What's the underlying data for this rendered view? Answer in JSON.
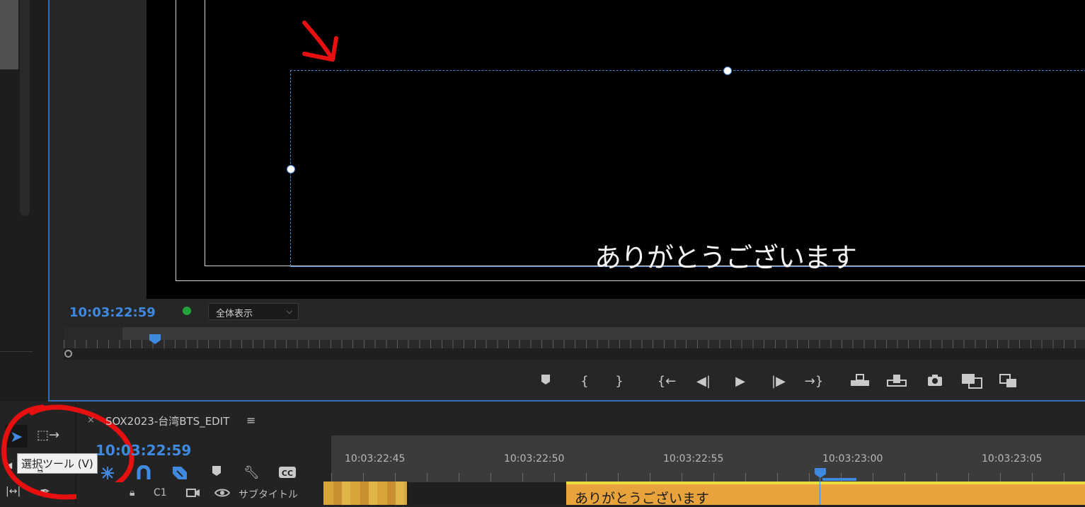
{
  "monitor": {
    "caption_text": "ありがとうございます",
    "timecode": "10:03:22:59",
    "zoom_value": "全体表示",
    "zoom_chevron_icon": "chevron-down-icon"
  },
  "transport_icons": [
    "add-marker-icon",
    "mark-in-icon",
    "mark-out-icon",
    "go-to-in-icon",
    "step-back-icon",
    "play-icon",
    "step-forward-icon",
    "go-to-out-icon",
    "insert-icon",
    "overwrite-icon",
    "export-frame-icon",
    "comparison-view-icon",
    "loop-icon"
  ],
  "tools": {
    "tooltip": "選択ツール (V)",
    "selection_icon": "selection-tool-icon",
    "track_select_icon": "track-select-forward-icon",
    "ripple_icon": "ripple-edit-icon",
    "slip_icon": "slip-tool-icon",
    "pen_icon": "pen-tool-icon"
  },
  "sequence": {
    "tab_name": "SOX2023-台湾BTS_EDIT",
    "close_label": "×",
    "menu_label": "≡",
    "timecode": "10:03:22:59"
  },
  "timeline": {
    "ruler_labels": [
      "10:03:22:45",
      "10:03:22:50",
      "10:03:22:55",
      "10:03:23:00",
      "10:03:23:05"
    ],
    "track": {
      "name": "C1",
      "label": "サブタイトル"
    },
    "caption_clip_text": "ありがとうございます"
  },
  "colors": {
    "accent": "#3f8ae0",
    "annotation_red": "#e61010",
    "caption_clip": "#e8a33c",
    "status_green": "#23a43a"
  }
}
